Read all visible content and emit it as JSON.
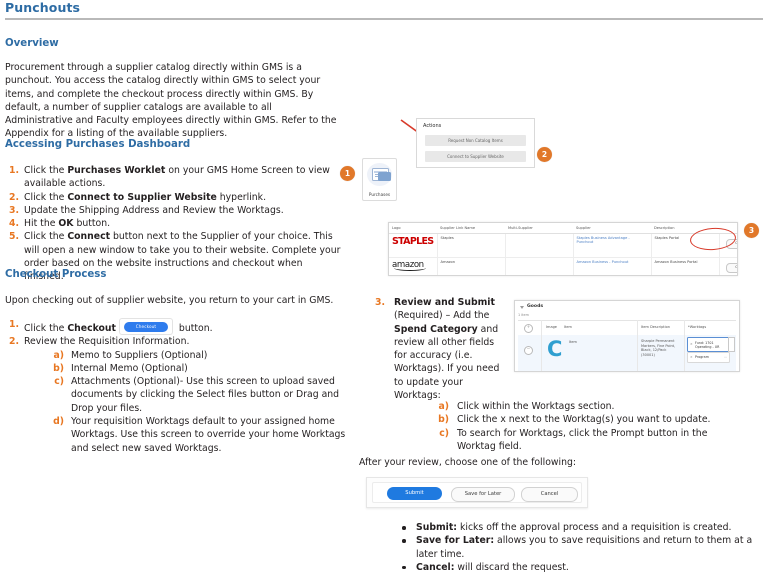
{
  "document": {
    "title": "Punchouts"
  },
  "sections": {
    "overview": {
      "heading": "Overview",
      "paragraph": "Procurement through a supplier catalog directly within GMS is a punchout.  You access the catalog directly within GMS to select your items, and complete the checkout process directly within GMS.  By default, a number of supplier catalogs are available to all Administrative and Faculty employees directly within GMS.  Refer to the Appendix for a listing of the available suppliers."
    },
    "accessing": {
      "heading": "Accessing Purchases Dashboard",
      "steps": [
        {
          "marker": "1.",
          "pre": "Click the ",
          "bold": "Purchases Worklet",
          "post": " on your GMS Home Screen to view available actions."
        },
        {
          "marker": "2.",
          "pre": "Click the ",
          "bold": "Connect to Supplier Website",
          "post": " hyperlink."
        },
        {
          "marker": "3.",
          "pre": "Update the Shipping Address and Review the Worktags.",
          "bold": "",
          "post": ""
        },
        {
          "marker": "4.",
          "pre": "Hit the ",
          "bold": "OK",
          "post": " button."
        },
        {
          "marker": "5.",
          "pre": "Click the ",
          "bold": "Connect",
          "post": " button next to the Supplier of your choice. This will open a new window to take you to their website. Complete your order based on the website instructions and checkout when finished."
        }
      ]
    },
    "checkout": {
      "heading": "Checkout Process",
      "paragraph": "Upon checking out of supplier website, you return to your cart in GMS.",
      "step1": {
        "marker": "1.",
        "pre": "Click the ",
        "bold": "Checkout",
        "button_label": "Checkout",
        "post": " button."
      },
      "step2": {
        "marker": "2.",
        "text": "Review the Requisition Information."
      },
      "sub_items": [
        {
          "marker": "a)",
          "text": "Memo to Suppliers (Optional)"
        },
        {
          "marker": "b)",
          "text": "Internal Memo (Optional)"
        },
        {
          "marker": "c)",
          "text": "Attachments (Optional)- Use this screen to upload saved documents by clicking the Select files button or Drag and Drop your files."
        },
        {
          "marker": "d)",
          "text": "Your requisition Worktags default to your assigned home Worktags. Use this screen to override your home Worktags and select new saved Worktags."
        }
      ]
    }
  },
  "annotations": {
    "badge_1": "1",
    "badge_2": "2",
    "badge_3": "3"
  },
  "worklet": {
    "label": "Purchases",
    "icon": "credit-card-icon"
  },
  "actions_card": {
    "title": "Actions",
    "buttons": [
      "Request Non Catalog Items",
      "Connect to Supplier Website"
    ]
  },
  "supplier_table": {
    "columns": [
      "Logo",
      "Supplier Link Name",
      "Multi-Supplier",
      "Supplier",
      "Description",
      ""
    ],
    "rows": [
      {
        "logo": "STAPLES",
        "logo_type": "staples-logo",
        "link_name": "Staples",
        "multi_supplier": "",
        "supplier": "Staples Business Advantage - Punchout",
        "description": "Staples Portal",
        "action": "Connect"
      },
      {
        "logo": "amazon",
        "logo_type": "amazon-logo",
        "link_name": "Amazon",
        "multi_supplier": "",
        "supplier": "Amazon Business - Punchout",
        "description": "Amazon Business Portal",
        "action": "Connect"
      }
    ]
  },
  "review_submit": {
    "marker": "3.",
    "bold1": "Review and Submit",
    "mid1": " (Required) – Add the ",
    "bold2": "Spend Category",
    "mid2": " and review all other fields for accuracy (i.e. Worktags). If you need to update your Worktags:",
    "sub_items": [
      {
        "marker": "a)",
        "text": "Click within the Worktags section."
      },
      {
        "marker": "b)",
        "text": "Click the x next to the Worktag(s) you want to update."
      },
      {
        "marker": "c)",
        "text": "To search for Worktags, click the Prompt button in the Worktag field."
      }
    ],
    "after_review": "After your review, choose one of the following:"
  },
  "goods_panel": {
    "title": "Goods",
    "item_count": "1 item",
    "columns": [
      "Image",
      "Item",
      "Item Description",
      "*Worktags"
    ],
    "row": {
      "item_label": "Item",
      "description": "Sharpie Permanent Markers, Fine Point, Black, 12/Pack (30001)",
      "worktags": [
        "Fund: 1701 Operating - UR",
        "Program"
      ]
    }
  },
  "submit_bar": {
    "submit": "Submit",
    "save_for_later": "Save for Later",
    "cancel": "Cancel"
  },
  "bottom_bullets": [
    {
      "bold": "Submit:",
      "text": " kicks off the approval process and a requisition is created."
    },
    {
      "bold": "Save for Later:",
      "text": " allows you to save requisitions and return to them at a later time."
    },
    {
      "bold": "Cancel:",
      "text": " will discard the request."
    }
  ],
  "colors": {
    "heading_blue": "#2e6ca4",
    "marker_orange": "#e87722",
    "badge_orange": "#e1782a",
    "link_blue": "#4b7fc4",
    "submit_blue": "#1f7ae0",
    "highlight_red": "#d83a2a"
  }
}
